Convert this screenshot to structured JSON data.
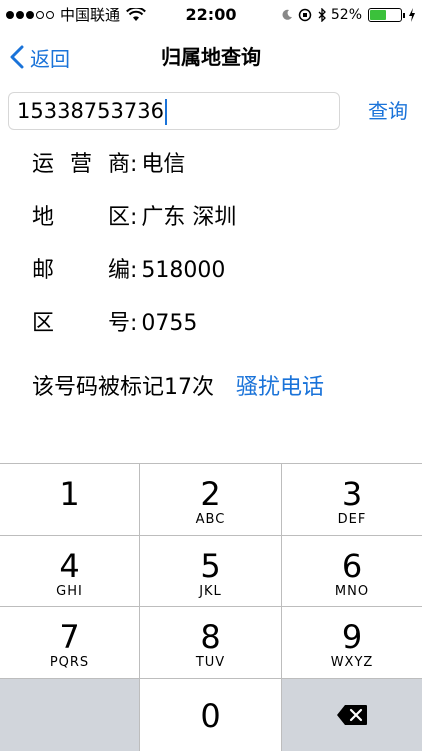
{
  "status_bar": {
    "carrier": "中国联通",
    "time": "22:00",
    "battery": "52%",
    "battery_level": 0.52,
    "icons": [
      "wifi-icon",
      "orientation-lock-icon",
      "moon-icon",
      "bluetooth-icon",
      "charging-icon"
    ]
  },
  "nav": {
    "back_label": "返回",
    "title": "归属地查询"
  },
  "search": {
    "value": "15338753736",
    "button_label": "查询"
  },
  "info": [
    {
      "label": "运营商",
      "value": "电信"
    },
    {
      "label": "地区",
      "value": "广东 深圳"
    },
    {
      "label": "邮编",
      "value": "518000"
    },
    {
      "label": "区号",
      "value": "0755"
    }
  ],
  "colon": ":",
  "marked": {
    "text": "该号码被标记17次",
    "tag": "骚扰电话"
  },
  "keypad": [
    {
      "num": "1",
      "letters": ""
    },
    {
      "num": "2",
      "letters": "ABC"
    },
    {
      "num": "3",
      "letters": "DEF"
    },
    {
      "num": "4",
      "letters": "GHI"
    },
    {
      "num": "5",
      "letters": "JKL"
    },
    {
      "num": "6",
      "letters": "MNO"
    },
    {
      "num": "7",
      "letters": "PQRS"
    },
    {
      "num": "8",
      "letters": "TUV"
    },
    {
      "num": "9",
      "letters": "WXYZ"
    },
    {
      "num": "0",
      "letters": ""
    }
  ],
  "colors": {
    "accent": "#1a73d9",
    "keypad_gray": "#d1d5db",
    "battery_fill": "#3bc13b"
  }
}
